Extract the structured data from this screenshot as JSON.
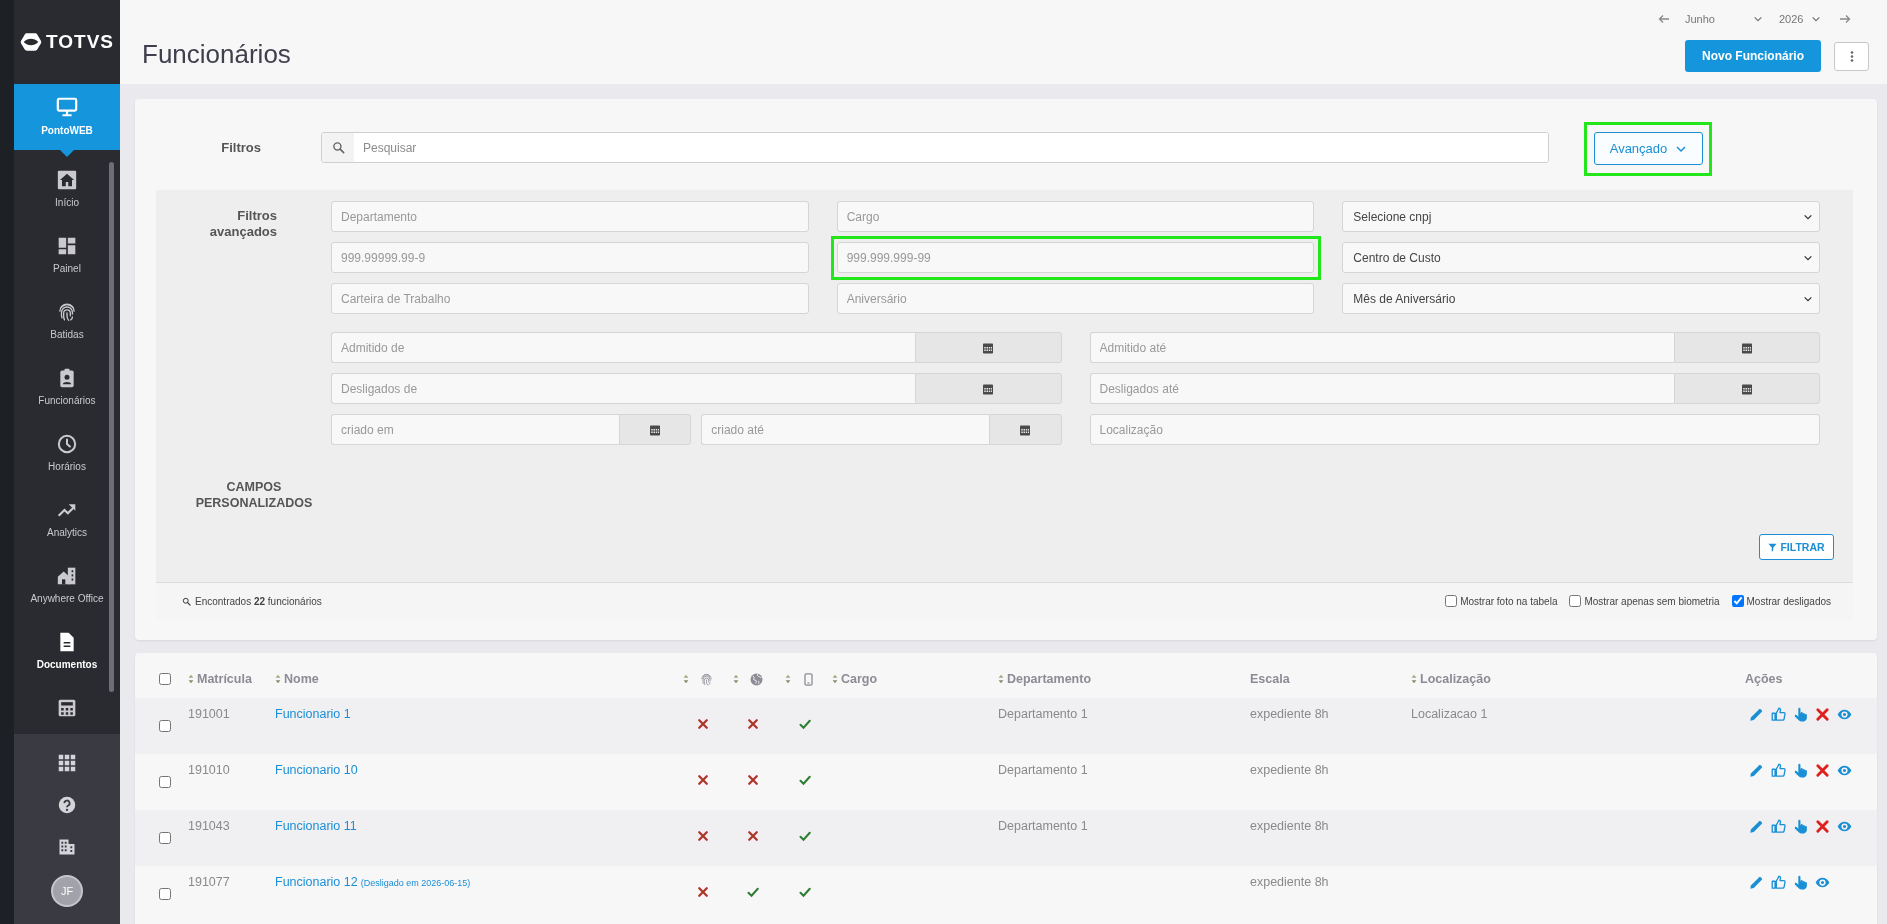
{
  "sidebar": {
    "logo": "TOTVS",
    "items": [
      {
        "label": "PontoWEB",
        "selected": true,
        "hovered": false
      },
      {
        "label": "Início",
        "selected": false,
        "hovered": false
      },
      {
        "label": "Painel",
        "selected": false,
        "hovered": false
      },
      {
        "label": "Batidas",
        "selected": false,
        "hovered": false
      },
      {
        "label": "Funcionários",
        "selected": false,
        "hovered": false
      },
      {
        "label": "Horários",
        "selected": false,
        "hovered": false
      },
      {
        "label": "Analytics",
        "selected": false,
        "hovered": false
      },
      {
        "label": "Anywhere Office",
        "selected": false,
        "hovered": false
      },
      {
        "label": "Documentos",
        "selected": false,
        "hovered": true
      }
    ],
    "avatar": "JF"
  },
  "header": {
    "title": "Funcionários",
    "month": "Junho",
    "year": "2026",
    "new_button": "Novo Funcionário"
  },
  "filters": {
    "label": "Filtros",
    "search_placeholder": "Pesquisar",
    "advanced_button": {
      "label": "Avançado",
      "expanded": true,
      "highlighted": true
    }
  },
  "advanced_filters": {
    "label": "Filtros avançados",
    "fields": [
      {
        "kind": "input",
        "placeholder": "Departamento",
        "highlighted": false
      },
      {
        "kind": "input",
        "placeholder": "Cargo",
        "highlighted": false
      },
      {
        "kind": "select",
        "value": "Selecione cnpj",
        "highlighted": false
      },
      {
        "kind": "input",
        "placeholder": "999.99999.99-9",
        "highlighted": false
      },
      {
        "kind": "input",
        "placeholder": "999.999.999-99",
        "highlighted": true
      },
      {
        "kind": "select",
        "value": "Centro de Custo",
        "highlighted": false
      },
      {
        "kind": "input",
        "placeholder": "Carteira de Trabalho",
        "highlighted": false
      },
      {
        "kind": "input",
        "placeholder": "Aniversário",
        "highlighted": false
      },
      {
        "kind": "select",
        "value": "Mês de Aniversário",
        "highlighted": false
      }
    ],
    "date_rows": [
      {
        "fields": [
          {
            "kind": "date",
            "placeholder": "Admitido de",
            "highlighted": false
          },
          {
            "kind": "date",
            "placeholder": "Admitido até",
            "highlighted": false
          }
        ]
      },
      {
        "fields": [
          {
            "kind": "date",
            "placeholder": "Desligados de",
            "highlighted": false
          },
          {
            "kind": "date",
            "placeholder": "Desligados até",
            "highlighted": false
          }
        ]
      },
      {
        "fields": [
          {
            "kind": "date",
            "placeholder": "criado em",
            "highlighted": false
          },
          {
            "kind": "date",
            "placeholder": "criado até",
            "highlighted": false
          },
          {
            "kind": "input",
            "placeholder": "Localização",
            "highlighted": false
          }
        ]
      }
    ],
    "custom_fields_label": "CAMPOS PERSONALIZADOS",
    "filter_button": "FILTRAR"
  },
  "results": {
    "summary": "Encontrados **22** funcionários",
    "options": [
      {
        "label": "Mostrar foto na tabela",
        "checked": false
      },
      {
        "label": "Mostrar apenas sem biometria",
        "checked": false
      },
      {
        "label": "Mostrar desligados",
        "checked": true
      }
    ]
  },
  "table": {
    "all_selected": false,
    "columns": [
      {
        "kind": "text",
        "label": "Matrícula",
        "sortable": true
      },
      {
        "kind": "name",
        "label": "Nome",
        "sortable": true
      },
      {
        "kind": "icon",
        "sortable": true
      },
      {
        "kind": "icon",
        "sortable": true
      },
      {
        "kind": "icon",
        "sortable": true
      },
      {
        "kind": "text",
        "label": "Cargo",
        "sortable": true
      },
      {
        "kind": "text",
        "label": "Departamento",
        "sortable": true
      },
      {
        "kind": "text",
        "label": "Escala",
        "sortable": false
      },
      {
        "kind": "text",
        "label": "Localização",
        "sortable": true
      },
      {
        "kind": "actions",
        "label": "Ações",
        "sortable": false
      }
    ],
    "rows": [
      {
        "selected": false,
        "matricula": "191001",
        "nome": "Funcionario 1",
        "flags": [
          false,
          false,
          true
        ],
        "departamento": "Departamento 1",
        "escala": "expediente 8h",
        "localizacao": "Localizacao 1",
        "deletable": true
      },
      {
        "selected": false,
        "matricula": "191010",
        "nome": "Funcionario 10",
        "flags": [
          false,
          false,
          true
        ],
        "departamento": "Departamento 1",
        "escala": "expediente 8h",
        "deletable": true
      },
      {
        "selected": false,
        "matricula": "191043",
        "nome": "Funcionario 11",
        "flags": [
          false,
          false,
          true
        ],
        "departamento": "Departamento 1",
        "escala": "expediente 8h",
        "deletable": true
      },
      {
        "selected": false,
        "matricula": "191077",
        "nome": "Funcionario 12",
        "note": "(Desligado em 2026-06-15)",
        "flags": [
          false,
          true,
          true
        ],
        "escala": "expediente 8h",
        "deletable": false
      }
    ]
  }
}
